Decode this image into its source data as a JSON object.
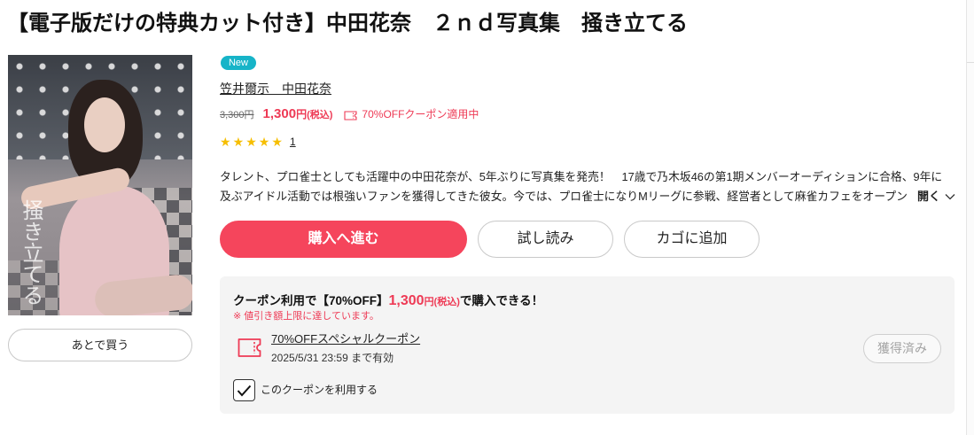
{
  "page": {
    "title": "【電子版だけの特典カット付き】中田花奈　２ｎｄ写真集　掻き立てる"
  },
  "cover": {
    "art_text": "掻き立てる"
  },
  "wishlist_button": "あとで買う",
  "badge": "New",
  "author": "笠井爾示　中田花奈",
  "price": {
    "original": "3,300円",
    "current": "1,300",
    "current_unit": "円",
    "tax_note": "(税込)",
    "coupon_status": "70%OFFクーポン適用中"
  },
  "rating": {
    "stars": 5,
    "max_stars": 5,
    "review_count": "1"
  },
  "description": {
    "lines": [
      "タレント、プロ雀士としても活躍中の中田花奈が、5年ぶりに写真集を発売！　17歳で乃木坂46の第1期メンバーオーディションに合格、9年に",
      "及ぶアイドル活動では根強いファンを獲得してきた彼女。今では、プロ雀士になりMリーグに参戦、経営者として麻雀カフェをオープン"
    ],
    "expand_label": "開く"
  },
  "actions": {
    "buy": "購入へ進む",
    "trial": "試し読み",
    "cart": "カゴに追加"
  },
  "coupon": {
    "headline_prefix": "クーポン利用で【70%OFF】",
    "price": "1,300",
    "price_unit": "円(税込)",
    "headline_suffix": "で購入できる！",
    "notice": "※ 値引き額上限に達しています。",
    "name": "70%OFFスペシャルクーポン",
    "expiry": "2025/5/31 23:59 まで有効",
    "acquired_label": "獲得済み",
    "use_label": "このクーポンを利用する",
    "use_checked": true
  },
  "icons": {
    "star": "star-icon",
    "coupon": "coupon-ticket-icon",
    "expand": "chevron-down-icon",
    "check": "checkmark-icon"
  },
  "colors": {
    "accent": "#f5455c",
    "price_red": "#ee3a55",
    "badge": "#17b4c8",
    "star": "#f6be00",
    "coupon_bg": "#f4f4f4"
  }
}
